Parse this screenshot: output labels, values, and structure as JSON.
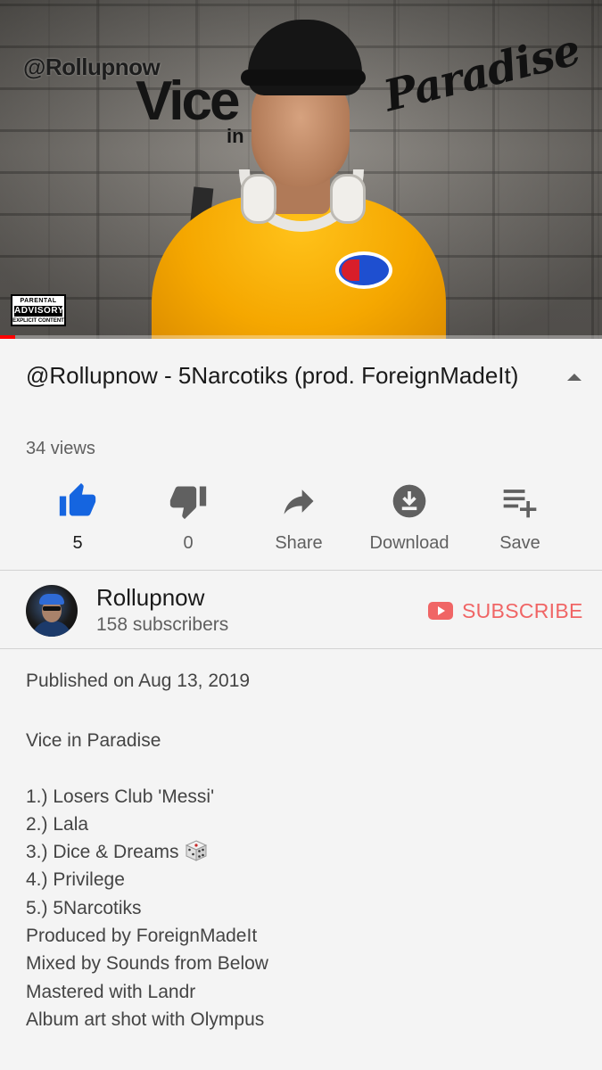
{
  "video": {
    "thumbnail_text": {
      "handle": "@Rollupnow",
      "vice": "Vice",
      "in": "in",
      "paradise": "Paradise",
      "advisory_top": "PARENTAL",
      "advisory_mid": "ADVISORY",
      "advisory_bottom": "EXPLICIT CONTENT"
    },
    "progress_fraction": 0.025,
    "progress_color": "#ff0000"
  },
  "title": "@Rollupnow - 5Narcotiks (prod. ForeignMadeIt)",
  "views": "34 views",
  "actions": [
    {
      "name": "like",
      "icon": "thumbs-up-icon",
      "label": "5",
      "color": "#1565e0"
    },
    {
      "name": "dislike",
      "icon": "thumbs-down-icon",
      "label": "0"
    },
    {
      "name": "share",
      "icon": "share-icon",
      "label": "Share"
    },
    {
      "name": "download",
      "icon": "download-icon",
      "label": "Download"
    },
    {
      "name": "save",
      "icon": "playlist-add-icon",
      "label": "Save"
    }
  ],
  "channel": {
    "name": "Rollupnow",
    "subscribers": "158 subscribers",
    "subscribe_label": "SUBSCRIBE",
    "subscribe_color": "#f06565"
  },
  "description": {
    "published": "Published on Aug 13, 2019",
    "lines": [
      "Vice in Paradise",
      "",
      "1.) Losers Club 'Messi'",
      "2.) Lala",
      "3.) Dice & Dreams",
      "4.) Privilege",
      "5.) 5Narcotiks",
      "Produced by ForeignMadeIt",
      "Mixed by Sounds from Below",
      "Mastered with Landr",
      "Album art shot with Olympus"
    ],
    "emoji_after_line_3": "dice-icon"
  }
}
